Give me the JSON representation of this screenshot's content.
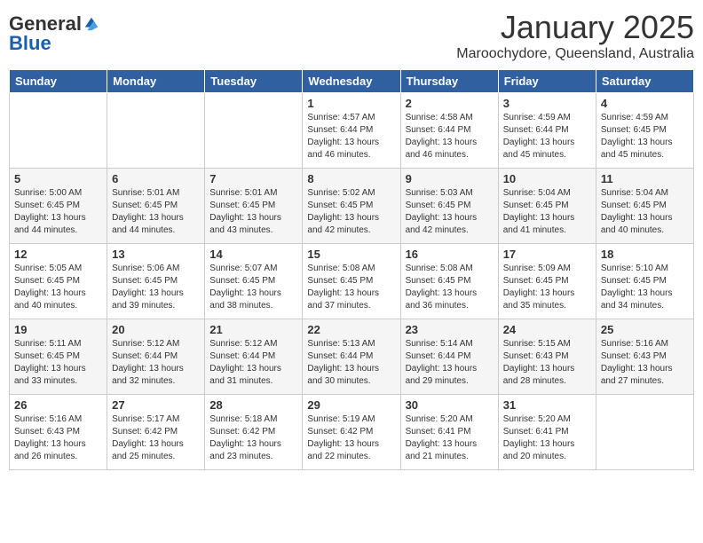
{
  "logo": {
    "general": "General",
    "blue": "Blue"
  },
  "header": {
    "month": "January 2025",
    "location": "Maroochydore, Queensland, Australia"
  },
  "weekdays": [
    "Sunday",
    "Monday",
    "Tuesday",
    "Wednesday",
    "Thursday",
    "Friday",
    "Saturday"
  ],
  "weeks": [
    [
      {
        "day": "",
        "info": ""
      },
      {
        "day": "",
        "info": ""
      },
      {
        "day": "",
        "info": ""
      },
      {
        "day": "1",
        "info": "Sunrise: 4:57 AM\nSunset: 6:44 PM\nDaylight: 13 hours\nand 46 minutes."
      },
      {
        "day": "2",
        "info": "Sunrise: 4:58 AM\nSunset: 6:44 PM\nDaylight: 13 hours\nand 46 minutes."
      },
      {
        "day": "3",
        "info": "Sunrise: 4:59 AM\nSunset: 6:44 PM\nDaylight: 13 hours\nand 45 minutes."
      },
      {
        "day": "4",
        "info": "Sunrise: 4:59 AM\nSunset: 6:45 PM\nDaylight: 13 hours\nand 45 minutes."
      }
    ],
    [
      {
        "day": "5",
        "info": "Sunrise: 5:00 AM\nSunset: 6:45 PM\nDaylight: 13 hours\nand 44 minutes."
      },
      {
        "day": "6",
        "info": "Sunrise: 5:01 AM\nSunset: 6:45 PM\nDaylight: 13 hours\nand 44 minutes."
      },
      {
        "day": "7",
        "info": "Sunrise: 5:01 AM\nSunset: 6:45 PM\nDaylight: 13 hours\nand 43 minutes."
      },
      {
        "day": "8",
        "info": "Sunrise: 5:02 AM\nSunset: 6:45 PM\nDaylight: 13 hours\nand 42 minutes."
      },
      {
        "day": "9",
        "info": "Sunrise: 5:03 AM\nSunset: 6:45 PM\nDaylight: 13 hours\nand 42 minutes."
      },
      {
        "day": "10",
        "info": "Sunrise: 5:04 AM\nSunset: 6:45 PM\nDaylight: 13 hours\nand 41 minutes."
      },
      {
        "day": "11",
        "info": "Sunrise: 5:04 AM\nSunset: 6:45 PM\nDaylight: 13 hours\nand 40 minutes."
      }
    ],
    [
      {
        "day": "12",
        "info": "Sunrise: 5:05 AM\nSunset: 6:45 PM\nDaylight: 13 hours\nand 40 minutes."
      },
      {
        "day": "13",
        "info": "Sunrise: 5:06 AM\nSunset: 6:45 PM\nDaylight: 13 hours\nand 39 minutes."
      },
      {
        "day": "14",
        "info": "Sunrise: 5:07 AM\nSunset: 6:45 PM\nDaylight: 13 hours\nand 38 minutes."
      },
      {
        "day": "15",
        "info": "Sunrise: 5:08 AM\nSunset: 6:45 PM\nDaylight: 13 hours\nand 37 minutes."
      },
      {
        "day": "16",
        "info": "Sunrise: 5:08 AM\nSunset: 6:45 PM\nDaylight: 13 hours\nand 36 minutes."
      },
      {
        "day": "17",
        "info": "Sunrise: 5:09 AM\nSunset: 6:45 PM\nDaylight: 13 hours\nand 35 minutes."
      },
      {
        "day": "18",
        "info": "Sunrise: 5:10 AM\nSunset: 6:45 PM\nDaylight: 13 hours\nand 34 minutes."
      }
    ],
    [
      {
        "day": "19",
        "info": "Sunrise: 5:11 AM\nSunset: 6:45 PM\nDaylight: 13 hours\nand 33 minutes."
      },
      {
        "day": "20",
        "info": "Sunrise: 5:12 AM\nSunset: 6:44 PM\nDaylight: 13 hours\nand 32 minutes."
      },
      {
        "day": "21",
        "info": "Sunrise: 5:12 AM\nSunset: 6:44 PM\nDaylight: 13 hours\nand 31 minutes."
      },
      {
        "day": "22",
        "info": "Sunrise: 5:13 AM\nSunset: 6:44 PM\nDaylight: 13 hours\nand 30 minutes."
      },
      {
        "day": "23",
        "info": "Sunrise: 5:14 AM\nSunset: 6:44 PM\nDaylight: 13 hours\nand 29 minutes."
      },
      {
        "day": "24",
        "info": "Sunrise: 5:15 AM\nSunset: 6:43 PM\nDaylight: 13 hours\nand 28 minutes."
      },
      {
        "day": "25",
        "info": "Sunrise: 5:16 AM\nSunset: 6:43 PM\nDaylight: 13 hours\nand 27 minutes."
      }
    ],
    [
      {
        "day": "26",
        "info": "Sunrise: 5:16 AM\nSunset: 6:43 PM\nDaylight: 13 hours\nand 26 minutes."
      },
      {
        "day": "27",
        "info": "Sunrise: 5:17 AM\nSunset: 6:42 PM\nDaylight: 13 hours\nand 25 minutes."
      },
      {
        "day": "28",
        "info": "Sunrise: 5:18 AM\nSunset: 6:42 PM\nDaylight: 13 hours\nand 23 minutes."
      },
      {
        "day": "29",
        "info": "Sunrise: 5:19 AM\nSunset: 6:42 PM\nDaylight: 13 hours\nand 22 minutes."
      },
      {
        "day": "30",
        "info": "Sunrise: 5:20 AM\nSunset: 6:41 PM\nDaylight: 13 hours\nand 21 minutes."
      },
      {
        "day": "31",
        "info": "Sunrise: 5:20 AM\nSunset: 6:41 PM\nDaylight: 13 hours\nand 20 minutes."
      },
      {
        "day": "",
        "info": ""
      }
    ]
  ]
}
